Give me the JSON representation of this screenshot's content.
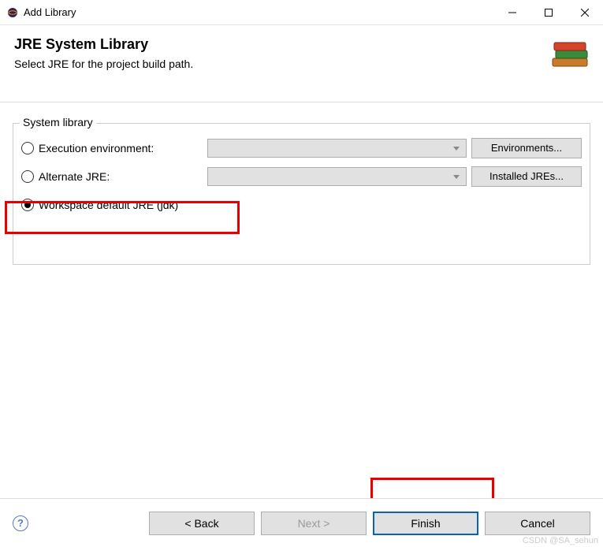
{
  "window": {
    "title": "Add Library"
  },
  "header": {
    "heading": "JRE System Library",
    "subtext": "Select JRE for the project build path."
  },
  "group": {
    "label": "System library",
    "options": {
      "exec_env": {
        "label": "Execution environment:",
        "selected": false,
        "button": "Environments..."
      },
      "alt_jre": {
        "label": "Alternate JRE:",
        "selected": false,
        "button": "Installed JREs..."
      },
      "workspace": {
        "label": "Workspace default JRE (jdk)",
        "selected": true
      }
    }
  },
  "footer": {
    "back": "< Back",
    "next": "Next >",
    "finish": "Finish",
    "cancel": "Cancel"
  },
  "watermark": "CSDN @SA_sehun"
}
